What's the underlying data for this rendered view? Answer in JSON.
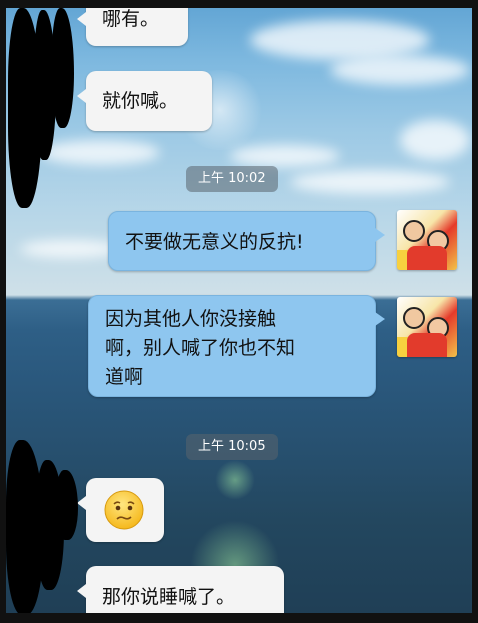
{
  "messages": [
    {
      "id": "m1",
      "side": "in",
      "text": "哪有。"
    },
    {
      "id": "m2",
      "side": "in",
      "text": "就你喊。"
    },
    {
      "id": "t1",
      "type": "timestamp",
      "text": "上午 10:02"
    },
    {
      "id": "m3",
      "side": "out",
      "text": "不要做无意义的反抗!"
    },
    {
      "id": "m4",
      "side": "out",
      "lines": [
        "因为其他人你没接触",
        "啊，别人喊了你也不知",
        "道啊"
      ]
    },
    {
      "id": "t2",
      "type": "timestamp",
      "text": "上午 10:05"
    },
    {
      "id": "m5",
      "side": "in",
      "emoji": "worried-face-emoji"
    },
    {
      "id": "m6",
      "side": "in",
      "text": "那你说睡喊了。"
    }
  ],
  "icons": {
    "self_avatar": "avatar-photo-two-girls",
    "emoji": "worried-face-emoji"
  },
  "colors": {
    "bubble_out": "#8ec6ef",
    "bubble_in": "#f4f4f4",
    "timestamp_bg": "rgba(90,100,110,0.55)"
  }
}
